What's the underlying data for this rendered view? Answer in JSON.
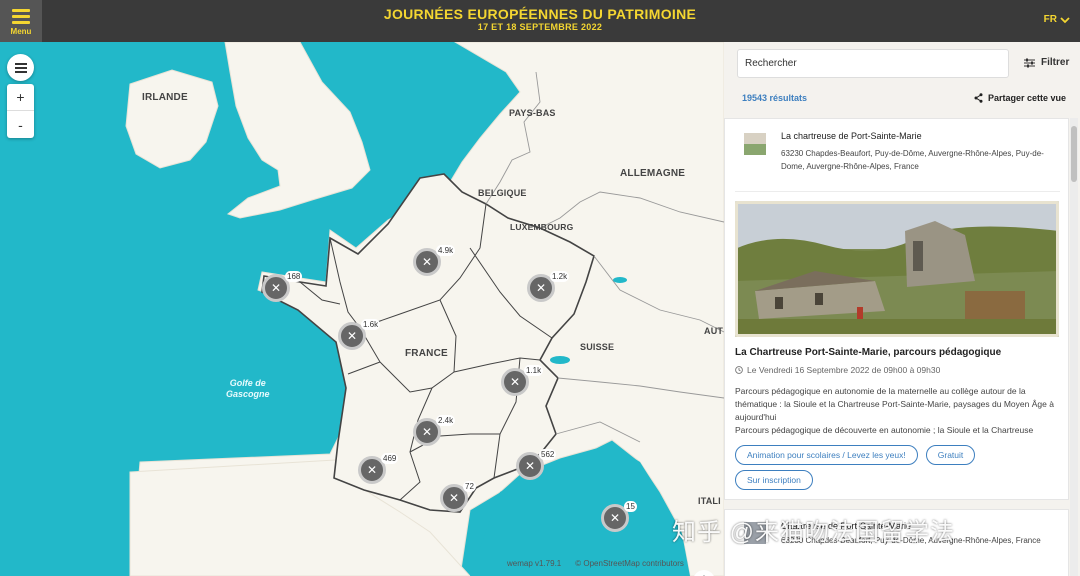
{
  "header": {
    "menu_label": "Menu",
    "title": "JOURNÉES EUROPÉENNES DU PATRIMOINE",
    "subtitle": "17 ET 18 SEPTEMBRE 2022",
    "language": "FR"
  },
  "map": {
    "zoom_in": "+",
    "zoom_out": "-",
    "country_labels": {
      "irlande": "IRLANDE",
      "pays_bas": "PAYS-BAS",
      "belgique": "BELGIQUE",
      "allemagne": "ALLEMAGNE",
      "luxembourg": "LUXEMBOURG",
      "france": "FRANCE",
      "suisse": "SUISSE",
      "aut": "AUT",
      "itali": "ITALI"
    },
    "sea_label_line1": "Golfe de",
    "sea_label_line2": "Gascogne",
    "clusters": {
      "bretagne": "168",
      "paris": "4.9k",
      "est": "1.2k",
      "loire": "1.6k",
      "lyon": "1.1k",
      "sud_ouest": "2.4k",
      "aquitaine": "469",
      "occitanie": "72",
      "paca": "562",
      "corse": "15"
    },
    "attribution_left": "wemap v1.79.1",
    "attribution_right": "© OpenStreetMap contributors",
    "watermark": "知乎 @来猫吻法国留学法"
  },
  "sidebar": {
    "search_placeholder": "Rechercher",
    "filter_label": "Filtrer",
    "results_count": "19543 résultats",
    "share_label": "Partager cette vue",
    "place": {
      "name": "La chartreuse de Port-Sainte-Marie",
      "address": "63230 Chapdes-Beaufort, Puy-de-Dôme, Auvergne-Rhône-Alpes, Puy-de-Dome, Auvergne-Rhône-Alpes, France"
    },
    "event": {
      "title": "La Chartreuse Port-Sainte-Marie, parcours pédagogique",
      "date": "Le Vendredi 16 Septembre 2022 de 09h00 à 09h30",
      "description_line1": "Parcours pédagogique en autonomie de la maternelle au collège autour de la thématique : la Sioule et la Chartreuse Port-Sainte-Marie, paysages du Moyen Âge à aujourd'hui",
      "description_line2": "Parcours pédagogique de découverte en autonomie ; la Sioule et la Chartreuse",
      "tags": [
        "Animation pour scolaires / Levez les yeux!",
        "Gratuit",
        "Sur inscription"
      ]
    },
    "next_place": {
      "name": "Chartreuse de Port-Sainte-Marie",
      "address": "63230 Chapdes-Beaufort, Puy-de-Dôme, Auvergne-Rhône-Alpes, France"
    }
  },
  "colors": {
    "header_bg": "#3a3a3a",
    "accent_yellow": "#f4d631",
    "sea": "#22b8c9",
    "land": "#f7f5ee",
    "link_blue": "#3d7fbf"
  }
}
